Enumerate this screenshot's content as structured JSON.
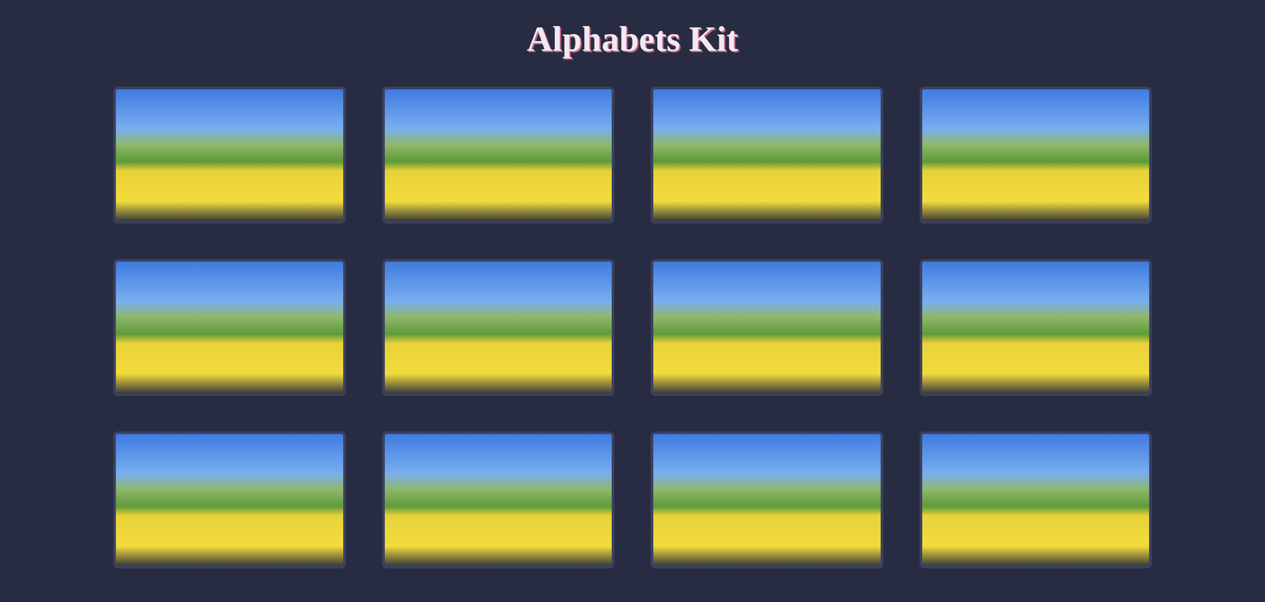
{
  "page": {
    "title": "Alphabets Kit"
  },
  "thumbnails": [
    {
      "kind": "image"
    },
    {
      "kind": "image"
    },
    {
      "kind": "image"
    },
    {
      "kind": "image"
    },
    {
      "kind": "image"
    },
    {
      "kind": "image"
    },
    {
      "kind": "image"
    },
    {
      "kind": "image"
    },
    {
      "kind": "image"
    },
    {
      "kind": "image"
    },
    {
      "kind": "image"
    },
    {
      "kind": "image"
    }
  ]
}
